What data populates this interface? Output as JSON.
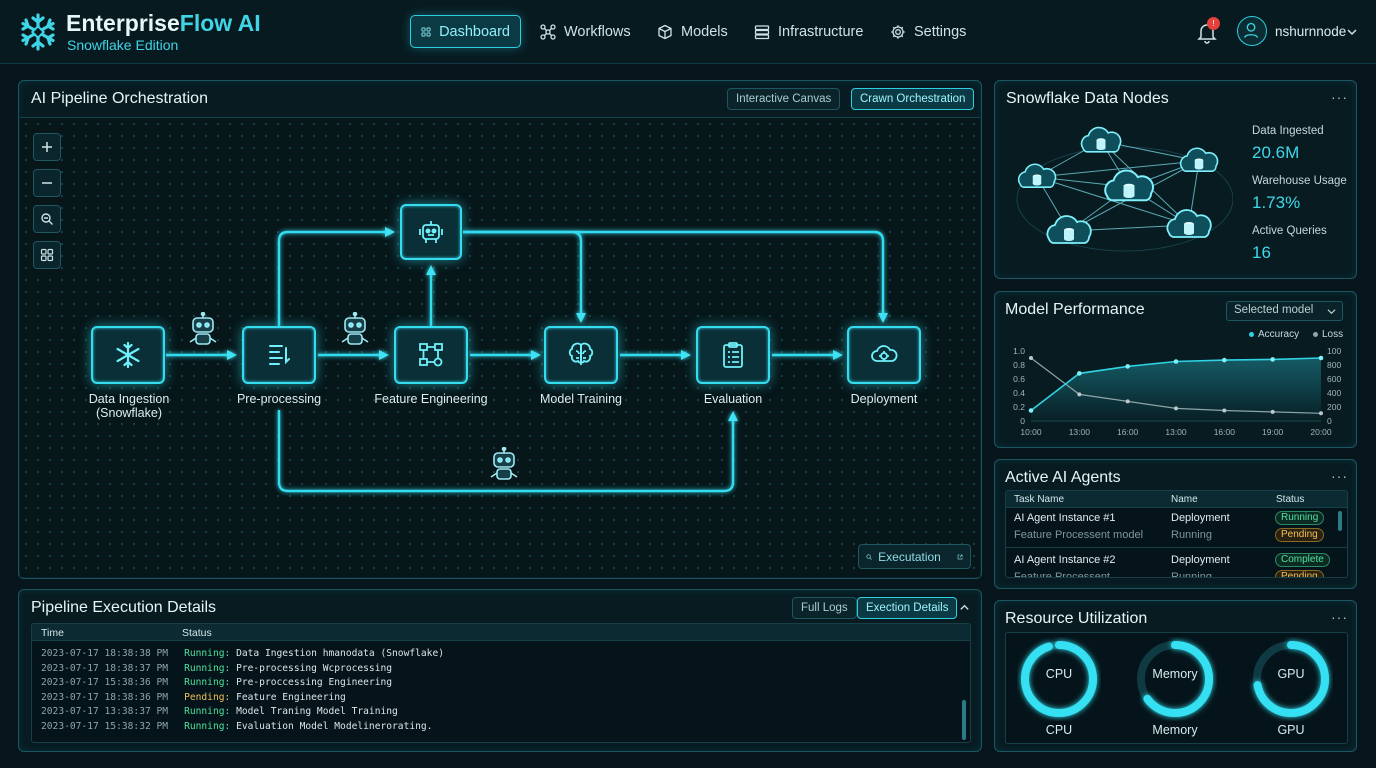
{
  "header": {
    "brand_title_part1": "Enterprise",
    "brand_title_part2": "Flow AI",
    "brand_subtitle": "Snowflake Edition",
    "nav": [
      {
        "label": "Dashboard",
        "icon": "grid-icon",
        "active": true
      },
      {
        "label": "Workflows",
        "icon": "workflow-icon",
        "active": false
      },
      {
        "label": "Models",
        "icon": "cube-icon",
        "active": false
      },
      {
        "label": "Infrastructure",
        "icon": "server-icon",
        "active": false
      },
      {
        "label": "Settings",
        "icon": "gear-icon",
        "active": false
      }
    ],
    "notification_count": "!",
    "user_name": "nshurnnode"
  },
  "pipeline": {
    "title": "AI Pipeline Orchestration",
    "view_buttons": [
      "Interactive Canvas",
      "Crawn Orchestration"
    ],
    "active_view": "Crawn Orchestration",
    "nodes": [
      {
        "id": "ingest",
        "label": "Data Ingestion\n(Snowflake)",
        "icon": "snowflake-icon"
      },
      {
        "id": "pre",
        "label": "Pre-processing",
        "icon": "document-list-icon"
      },
      {
        "id": "feat",
        "label": "Feature Engineering",
        "icon": "flowchart-icon"
      },
      {
        "id": "agent",
        "label": "",
        "icon": "robot-chip-icon"
      },
      {
        "id": "train",
        "label": "Model Training",
        "icon": "brain-icon"
      },
      {
        "id": "eval",
        "label": "Evaluation",
        "icon": "clipboard-icon"
      },
      {
        "id": "deploy",
        "label": "Deployment",
        "icon": "cloud-gear-icon"
      }
    ],
    "execution_button": "Executation"
  },
  "logs": {
    "title": "Pipeline Execution Details",
    "buttons": [
      "Full Logs",
      "Exection Details"
    ],
    "columns": [
      "Time",
      "Status"
    ],
    "rows": [
      {
        "time": "2023-07-17 18:38:38 PM",
        "status": "Running:",
        "msg": "Data Ingestion hmanodata (Snowflake)",
        "state": "run"
      },
      {
        "time": "2023-07-17 18:38:37 PM",
        "status": "Running:",
        "msg": "Pre-processing Wcprocessing",
        "state": "run"
      },
      {
        "time": "2023-07-17 15:38:36 PM",
        "status": "Running:",
        "msg": "Pre-proccessing Engineering",
        "state": "run"
      },
      {
        "time": "2023-07-17 18:38:36 PM",
        "status": "Pending:",
        "msg": "Feature Engineering",
        "state": "pend"
      },
      {
        "time": "2023-07-17 13:38:37 PM",
        "status": "Running:",
        "msg": "Model Traning Model Training",
        "state": "run"
      },
      {
        "time": "2023-07-17 15:38:32 PM",
        "status": "Running:",
        "msg": "Evaluation Model Modelinerorating.",
        "state": "run"
      }
    ]
  },
  "snowflake_nodes": {
    "title": "Snowflake Data Nodes",
    "stats": [
      {
        "label": "Data Ingested",
        "value": "20.6M"
      },
      {
        "label": "Warehouse Usage",
        "value": "1.73%"
      },
      {
        "label": "Active Queries",
        "value": "16"
      }
    ]
  },
  "model_performance": {
    "title": "Model Performance",
    "select_value": "Selected model",
    "accent_accuracy": "#2fd3e4",
    "accent_loss": "#8fa5aa"
  },
  "chart_data": {
    "type": "line",
    "title": "",
    "x": [
      "10:00",
      "13:00",
      "16:00",
      "13:00",
      "16:00",
      "19:00",
      "20:00"
    ],
    "series": [
      {
        "name": "Accuracy",
        "axis": "left",
        "values": [
          0.15,
          0.68,
          0.78,
          0.85,
          0.87,
          0.88,
          0.9
        ]
      },
      {
        "name": "Loss",
        "axis": "right",
        "values": [
          900,
          380,
          280,
          180,
          150,
          130,
          110
        ]
      }
    ],
    "ylim_left": [
      0,
      1.0
    ],
    "ylim_right": [
      0,
      1000
    ],
    "left_ticks": [
      "0",
      "0.2",
      "0.4",
      "0.6",
      "0.8",
      "1.0"
    ],
    "right_ticks": [
      "0",
      "200",
      "400",
      "600",
      "800",
      "100"
    ],
    "legend_position": "top-right",
    "grid": false
  },
  "agents": {
    "title": "Active AI Agents",
    "columns": [
      "Task Name",
      "Name",
      "Status"
    ],
    "rows": [
      {
        "task": "AI Agent Instance #1",
        "name": "Deployment",
        "status": "Running",
        "kind": "running"
      },
      {
        "task": "Feature Processent model",
        "name": "Running",
        "status": "Pending",
        "kind": "pending"
      },
      {
        "task": "AI Agent Instance #2",
        "name": "Deployment",
        "status": "Complete",
        "kind": "complete"
      },
      {
        "task": "Feature Processent",
        "name": "Running",
        "status": "Pending",
        "kind": "pending"
      }
    ]
  },
  "resources": {
    "title": "Resource Utilization",
    "gauges": [
      {
        "center": "CPU",
        "label": "CPU",
        "level": 0.95
      },
      {
        "center": "Memory",
        "label": "Memory",
        "level": 0.65
      },
      {
        "center": "GPU",
        "label": "GPU",
        "level": 0.72
      }
    ]
  }
}
